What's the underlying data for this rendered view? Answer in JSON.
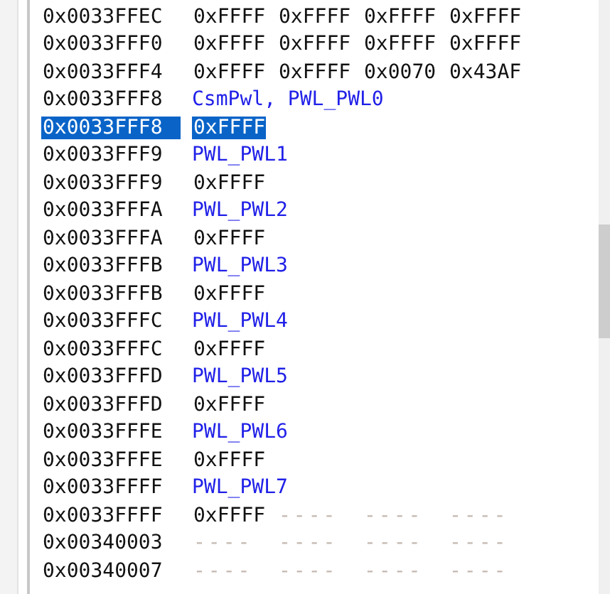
{
  "rows": [
    {
      "address": "0x0033FFEC",
      "kind": "data",
      "selected": false,
      "values": [
        "0xFFFF",
        "0xFFFF",
        "0xFFFF",
        "0xFFFF"
      ]
    },
    {
      "address": "0x0033FFF0",
      "kind": "data",
      "selected": false,
      "values": [
        "0xFFFF",
        "0xFFFF",
        "0xFFFF",
        "0xFFFF"
      ]
    },
    {
      "address": "0x0033FFF4",
      "kind": "data",
      "selected": false,
      "values": [
        "0xFFFF",
        "0xFFFF",
        "0x0070",
        "0x43AF"
      ]
    },
    {
      "address": "0x0033FFF8",
      "kind": "symbol",
      "selected": false,
      "text": "CsmPwl, PWL_PWL0"
    },
    {
      "address": "0x0033FFF8",
      "kind": "data",
      "selected": true,
      "values": [
        "0xFFFF"
      ]
    },
    {
      "address": "0x0033FFF9",
      "kind": "symbol",
      "selected": false,
      "text": "PWL_PWL1"
    },
    {
      "address": "0x0033FFF9",
      "kind": "data",
      "selected": false,
      "values": [
        "0xFFFF"
      ]
    },
    {
      "address": "0x0033FFFA",
      "kind": "symbol",
      "selected": false,
      "text": "PWL_PWL2"
    },
    {
      "address": "0x0033FFFA",
      "kind": "data",
      "selected": false,
      "values": [
        "0xFFFF"
      ]
    },
    {
      "address": "0x0033FFFB",
      "kind": "symbol",
      "selected": false,
      "text": "PWL_PWL3"
    },
    {
      "address": "0x0033FFFB",
      "kind": "data",
      "selected": false,
      "values": [
        "0xFFFF"
      ]
    },
    {
      "address": "0x0033FFFC",
      "kind": "symbol",
      "selected": false,
      "text": "PWL_PWL4"
    },
    {
      "address": "0x0033FFFC",
      "kind": "data",
      "selected": false,
      "values": [
        "0xFFFF"
      ]
    },
    {
      "address": "0x0033FFFD",
      "kind": "symbol",
      "selected": false,
      "text": "PWL_PWL5"
    },
    {
      "address": "0x0033FFFD",
      "kind": "data",
      "selected": false,
      "values": [
        "0xFFFF"
      ]
    },
    {
      "address": "0x0033FFFE",
      "kind": "symbol",
      "selected": false,
      "text": "PWL_PWL6"
    },
    {
      "address": "0x0033FFFE",
      "kind": "data",
      "selected": false,
      "values": [
        "0xFFFF"
      ]
    },
    {
      "address": "0x0033FFFF",
      "kind": "symbol",
      "selected": false,
      "text": "PWL_PWL7"
    },
    {
      "address": "0x0033FFFF",
      "kind": "data",
      "selected": false,
      "values": [
        "0xFFFF",
        "----",
        "----",
        "----"
      ]
    },
    {
      "address": "0x00340003",
      "kind": "data",
      "selected": false,
      "values": [
        "----",
        "----",
        "----",
        "----"
      ]
    },
    {
      "address": "0x00340007",
      "kind": "data",
      "selected": false,
      "values": [
        "----",
        "----",
        "----",
        "----"
      ]
    }
  ]
}
